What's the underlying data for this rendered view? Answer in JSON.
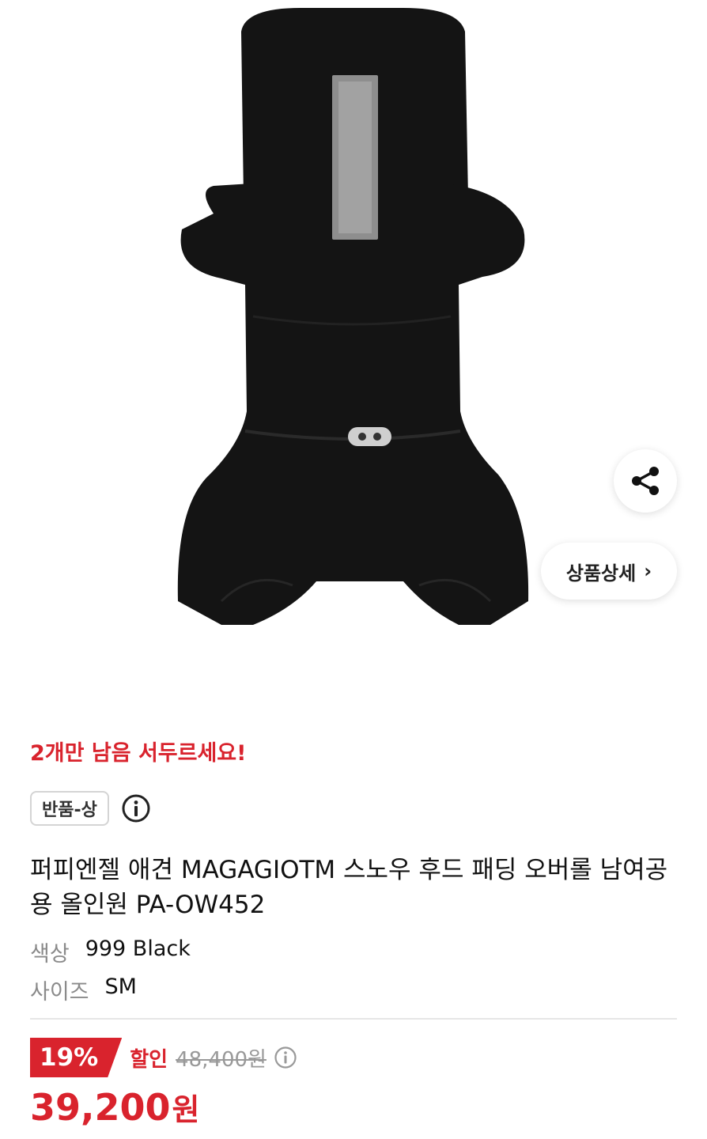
{
  "product": {
    "image_alt": "black dog snow hood padding overall",
    "stock_alert": "2개만 남음 서두르세요!",
    "return_badge": "반품-상",
    "title": "퍼피엔젤 애견 MAGAGIOTM 스노우 후드 패딩 오버롤 남여공용 올인원 PA-OW452",
    "options": [
      {
        "key": "색상",
        "value": "999 Black"
      },
      {
        "key": "사이즈",
        "value": "SM"
      }
    ]
  },
  "actions": {
    "detail_label": "상품상세",
    "share_icon": "share-icon"
  },
  "price": {
    "discount_percent": "19%",
    "discount_label": "할인",
    "original": "48,400원",
    "final": "39,200",
    "final_unit": "원"
  },
  "colors": {
    "accent": "#d9232d",
    "garment": "#141414",
    "reflector": "#8e8e8e"
  }
}
